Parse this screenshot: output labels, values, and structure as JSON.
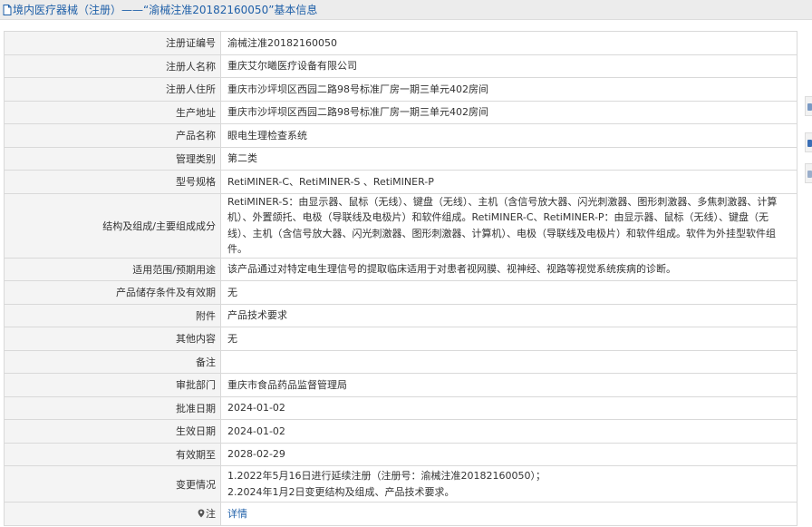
{
  "header": {
    "title": "境内医疗器械（注册）——“渝械注准20182160050”基本信息"
  },
  "rows": [
    {
      "label": "注册证编号",
      "value": "渝械注准20182160050"
    },
    {
      "label": "注册人名称",
      "value": "重庆艾尔曦医疗设备有限公司"
    },
    {
      "label": "注册人住所",
      "value": "重庆市沙坪坝区西园二路98号标准厂房一期三单元402房间"
    },
    {
      "label": "生产地址",
      "value": "重庆市沙坪坝区西园二路98号标准厂房一期三单元402房间"
    },
    {
      "label": "产品名称",
      "value": "眼电生理检查系统"
    },
    {
      "label": "管理类别",
      "value": "第二类"
    },
    {
      "label": "型号规格",
      "value": "RetiMINER-C、RetiMINER-S 、RetiMINER-P"
    },
    {
      "label": "结构及组成/主要组成成分",
      "value": "RetiMINER-S：由显示器、鼠标（无线）、键盘（无线）、主机（含信号放大器、闪光刺激器、图形刺激器、多焦刺激器、计算机）、外置颌托、电极（导联线及电极片）和软件组成。RetiMINER-C、RetiMINER-P：由显示器、鼠标（无线）、键盘（无线）、主机（含信号放大器、闪光刺激器、图形刺激器、计算机）、电极（导联线及电极片）和软件组成。软件为外挂型软件组件。"
    },
    {
      "label": "适用范围/预期用途",
      "value": "该产品通过对特定电生理信号的提取临床适用于对患者视网膜、视神经、视路等视觉系统疾病的诊断。"
    },
    {
      "label": "产品储存条件及有效期",
      "value": "无"
    },
    {
      "label": "附件",
      "value": "产品技术要求"
    },
    {
      "label": "其他内容",
      "value": "无"
    },
    {
      "label": "备注",
      "value": ""
    },
    {
      "label": "审批部门",
      "value": "重庆市食品药品监督管理局"
    },
    {
      "label": "批准日期",
      "value": "2024-01-02"
    },
    {
      "label": "生效日期",
      "value": "2024-01-02"
    },
    {
      "label": "有效期至",
      "value": "2028-02-29"
    },
    {
      "label": "变更情况",
      "value_lines": [
        "1.2022年5月16日进行延续注册（注册号：渝械注准20182160050）；",
        "2.2024年1月2日变更结构及组成、产品技术要求。"
      ]
    },
    {
      "label": "注",
      "link": "详情"
    }
  ],
  "colors": {
    "title_blue": "#1e5fa8",
    "label_bg": "#f4f4f4",
    "border": "#d9d9d9"
  },
  "icons": [
    "document-icon",
    "location-pin-icon"
  ]
}
